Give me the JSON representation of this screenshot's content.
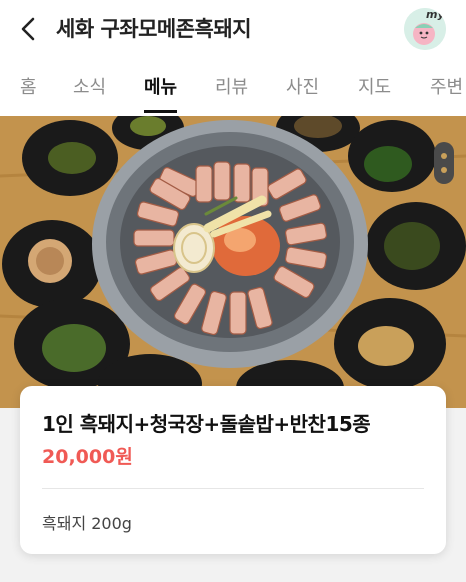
{
  "header": {
    "title": "세화 구좌모메존흑돼지",
    "my_label": "my"
  },
  "tabs": [
    {
      "label": "홈",
      "active": false
    },
    {
      "label": "소식",
      "active": false
    },
    {
      "label": "메뉴",
      "active": true
    },
    {
      "label": "리뷰",
      "active": false
    },
    {
      "label": "사진",
      "active": false
    },
    {
      "label": "지도",
      "active": false
    },
    {
      "label": "주변",
      "active": false
    }
  ],
  "menu_item": {
    "name": "1인 흑돼지+청국장+돌솥밥+반찬15종",
    "price": "20,000원",
    "description": "흑돼지 200g"
  },
  "colors": {
    "price": "#f05a55",
    "active_tab": "#111111",
    "inactive_tab": "#8c8c8c"
  }
}
